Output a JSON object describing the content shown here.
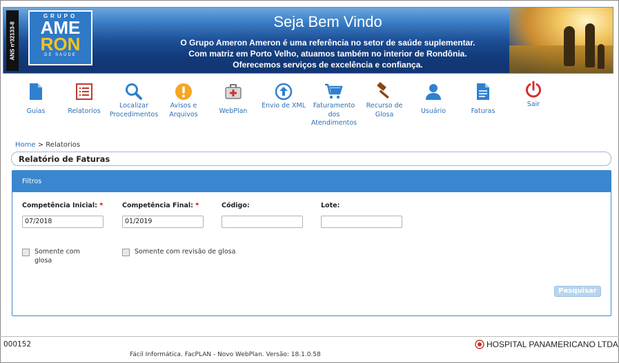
{
  "banner": {
    "ans": "ANS nº32133-8",
    "logo": {
      "top": "GRUPO",
      "line1": "AME",
      "line2": "RON",
      "sub": "DE SAÚDE"
    },
    "title": "Seja Bem Vindo",
    "lines": [
      "O Grupo Ameron Ameron é uma referência no setor de saúde suplementar.",
      "Com matriz em Porto Velho, atuamos também no interior de Rondônia.",
      "Oferecemos serviços de excelência e confiança."
    ]
  },
  "nav": {
    "items": [
      {
        "label": "Guias",
        "icon": "document-icon"
      },
      {
        "label": "Relatorios",
        "icon": "report-icon"
      },
      {
        "label": "Localizar Procedimentos",
        "icon": "search-icon"
      },
      {
        "label": "Avisos e Arquivos",
        "icon": "warning-icon"
      },
      {
        "label": "WebPlan",
        "icon": "medical-kit-icon"
      },
      {
        "label": "Envio de XML",
        "icon": "upload-icon"
      },
      {
        "label": "Faturamento dos Atendimentos",
        "icon": "cart-icon"
      },
      {
        "label": "Recurso de Glosa",
        "icon": "gavel-icon"
      },
      {
        "label": "Usuário",
        "icon": "user-icon"
      },
      {
        "label": "Faturas",
        "icon": "invoice-icon"
      },
      {
        "label": "Sair",
        "icon": "power-icon"
      }
    ]
  },
  "breadcrumb": {
    "home": "Home",
    "sep": ">",
    "current": "Relatorios"
  },
  "page_title": "Relatório de Faturas",
  "filters": {
    "header": "Filtros",
    "competencia_inicial": {
      "label": "Competência Inicial:",
      "value": "07/2018"
    },
    "competencia_final": {
      "label": "Competência Final:",
      "value": "01/2019"
    },
    "codigo": {
      "label": "Código:",
      "value": ""
    },
    "lote": {
      "label": "Lote:",
      "value": ""
    },
    "required_mark": "*",
    "somente_glosa": "Somente com glosa",
    "somente_revisao": "Somente com revisão de glosa",
    "search_button": "Pesquisar"
  },
  "footer": {
    "code": "000152",
    "hospital": "HOSPITAL PANAMERICANO LTDA",
    "version": "Fácil Informática. FacPLAN - Novo WebPlan. Versão: 18.1.0.58"
  },
  "colors": {
    "accent": "#3a87cf",
    "link": "#2f6fb3",
    "required": "#dd0000",
    "button": "#b8d4ef"
  }
}
